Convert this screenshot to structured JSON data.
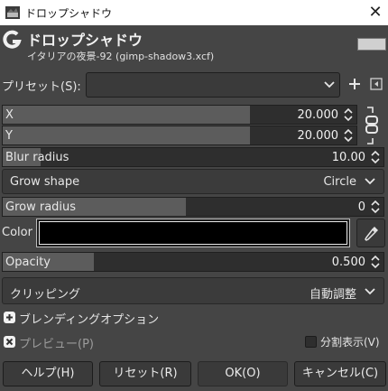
{
  "window": {
    "title": "ドロップシャドウ",
    "close_glyph": "✕"
  },
  "header": {
    "title": "ドロップシャドウ",
    "subtitle": "イタリアの夜景-92 (gimp-shadow3.xcf)"
  },
  "preset": {
    "label": "プリセット(S):",
    "value": ""
  },
  "fields": {
    "x": {
      "label": "X",
      "value": "20.000",
      "fill": 0.7
    },
    "y": {
      "label": "Y",
      "value": "20.000",
      "fill": 0.7
    },
    "blur_radius": {
      "label": "Blur radius",
      "value": "10.00",
      "fill": 0.1
    },
    "grow_shape": {
      "label": "Grow shape",
      "value": "Circle"
    },
    "grow_radius": {
      "label": "Grow radius",
      "value": "0",
      "fill": 0.48
    },
    "color": {
      "label": "Color",
      "swatch": "#000000"
    },
    "opacity": {
      "label": "Opacity",
      "value": "0.500",
      "fill": 0.24
    },
    "clipping": {
      "label": "クリッピング",
      "value": "自動調整"
    }
  },
  "blending": {
    "label": "ブレンディングオプション"
  },
  "preview": {
    "label": "プレビュー(P)",
    "split_label": "分割表示(V)"
  },
  "buttons": {
    "help": "ヘルプ(H)",
    "reset": "リセット(R)",
    "ok": "OK(O)",
    "cancel": "キャンセル(C)"
  },
  "icons": {
    "app": "gimp-app-icon",
    "close": "close-icon",
    "logo": "gimp-logo-icon",
    "add": "plus-icon",
    "menu": "preset-menu-icon",
    "chain": "chain-link-icon",
    "picker": "color-picker-icon"
  }
}
